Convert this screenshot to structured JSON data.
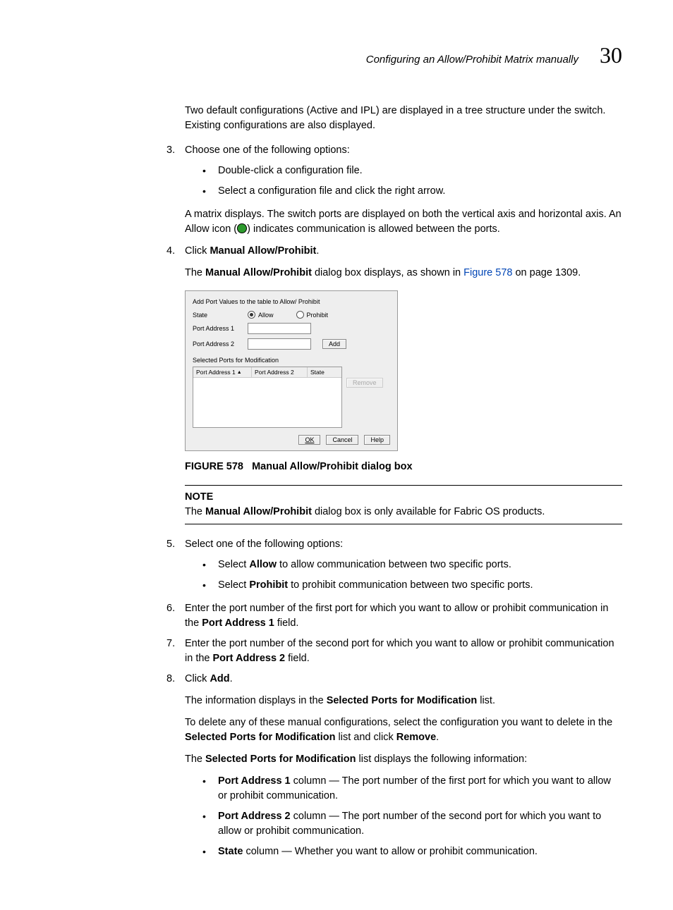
{
  "header": {
    "title": "Configuring an Allow/Prohibit Matrix manually",
    "chapter": "30"
  },
  "intro": "Two default configurations (Active and IPL) are displayed in a tree structure under the switch. Existing configurations are also displayed.",
  "step3": {
    "num": "3.",
    "lead": "Choose one of the following options:",
    "b1": "Double-click a configuration file.",
    "b2": "Select a configuration file and click the right arrow.",
    "after_a": "A matrix displays. The switch ports are displayed on both the vertical axis and horizontal axis. An Allow icon (",
    "after_b": ") indicates communication is allowed between the ports."
  },
  "step4": {
    "num": "4.",
    "lead_a": "Click ",
    "lead_b": "Manual Allow/Prohibit",
    "lead_c": ".",
    "after_a": "The ",
    "after_b": "Manual Allow/Prohibit",
    "after_c": " dialog box displays, as shown in ",
    "link": "Figure 578",
    "after_d": " on page 1309."
  },
  "dialog": {
    "title": "Add Port Values to the table to Allow/ Prohibit",
    "state": "State",
    "allow": "Allow",
    "prohibit": "Prohibit",
    "pa1": "Port Address 1",
    "pa2": "Port Address 2",
    "add": "Add",
    "section": "Selected Ports for Modification",
    "col1": "Port Address 1",
    "col2": "Port Address 2",
    "col3": "State",
    "remove": "Remove",
    "ok": "OK",
    "cancel": "Cancel",
    "help": "Help"
  },
  "figcap": {
    "num": "FIGURE 578",
    "text": "Manual Allow/Prohibit dialog box"
  },
  "note": {
    "label": "NOTE",
    "a": "The ",
    "b": "Manual Allow/Prohibit",
    "c": " dialog box is only available for Fabric OS products."
  },
  "step5": {
    "num": "5.",
    "lead": "Select one of the following options:",
    "b1a": "Select ",
    "b1b": "Allow",
    "b1c": " to allow communication between two specific ports.",
    "b2a": "Select ",
    "b2b": "Prohibit",
    "b2c": " to prohibit communication between two specific ports."
  },
  "step6": {
    "num": "6.",
    "a": "Enter the port number of the first port for which you want to allow or prohibit communication in the ",
    "b": "Port Address 1",
    "c": " field."
  },
  "step7": {
    "num": "7.",
    "a": "Enter the port number of the second port for which you want to allow or prohibit communication in the ",
    "b": "Port Address 2",
    "c": " field."
  },
  "step8": {
    "num": "8.",
    "a": "Click ",
    "b": "Add",
    "c": ".",
    "p1a": "The information displays in the ",
    "p1b": "Selected Ports for Modification",
    "p1c": " list.",
    "p2a": "To delete any of these manual configurations, select the configuration you want to delete in the ",
    "p2b": "Selected Ports for Modification",
    "p2c": " list and click ",
    "p2d": "Remove",
    "p2e": ".",
    "p3a": "The ",
    "p3b": "Selected Ports for Modification",
    "p3c": " list displays the following information:",
    "bl1a": "Port Address 1",
    "bl1b": " column — The port number of the first port for which you want to allow or prohibit communication.",
    "bl2a": "Port Address 2",
    "bl2b": " column — The port number of the second port for which you want to allow or prohibit communication.",
    "bl3a": "State",
    "bl3b": " column — Whether you want to allow or prohibit communication."
  }
}
